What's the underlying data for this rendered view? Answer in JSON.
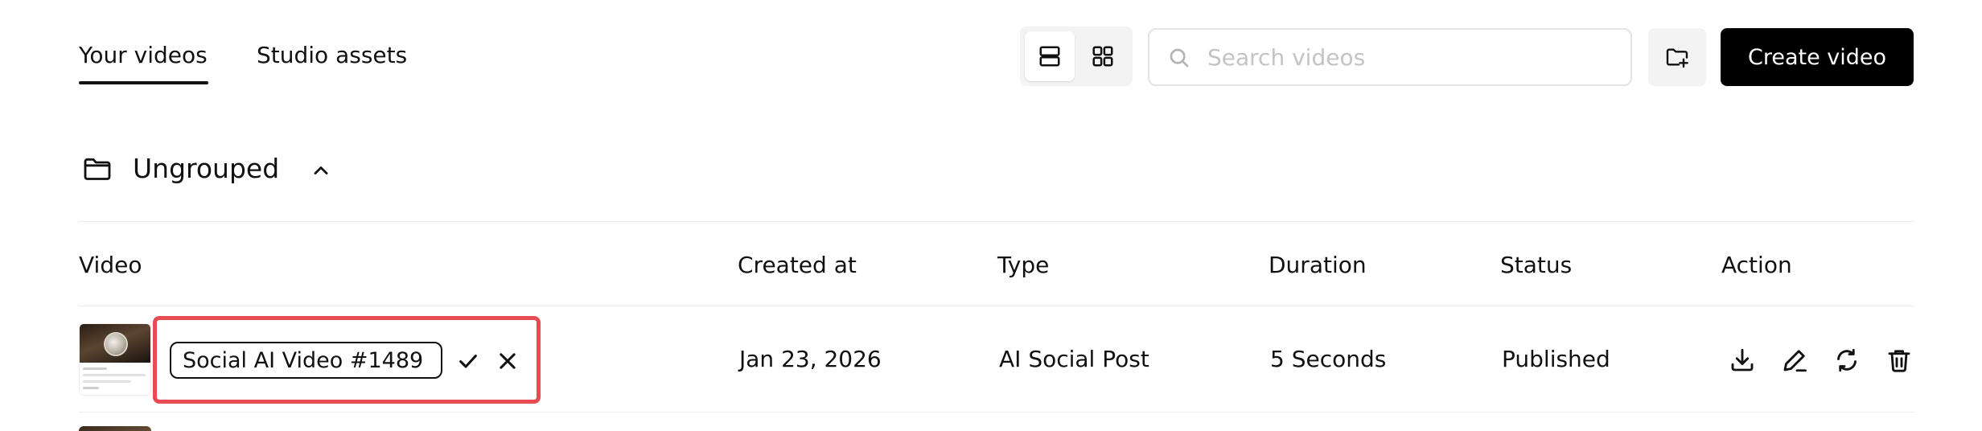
{
  "tabs": {
    "your_videos": "Your videos",
    "studio_assets": "Studio assets"
  },
  "toolbar": {
    "list_view_icon": "list-view-icon",
    "grid_view_icon": "grid-view-icon",
    "search_placeholder": "Search videos",
    "search_value": "",
    "new_folder_icon": "folder-plus-icon",
    "create_label": "Create video"
  },
  "group": {
    "title": "Ungrouped",
    "expanded": true
  },
  "table": {
    "headers": {
      "video": "Video",
      "created_at": "Created at",
      "type": "Type",
      "duration": "Duration",
      "status": "Status",
      "action": "Action"
    },
    "rows": [
      {
        "name": "Social AI Video #1489",
        "created_at": "Jan 23, 2026",
        "type": "AI Social Post",
        "duration": "5 Seconds",
        "status": "Published",
        "editing": true,
        "actions": [
          "download-icon",
          "edit-icon",
          "refresh-icon",
          "trash-icon"
        ]
      }
    ]
  },
  "colors": {
    "accent_border": "#e84b51",
    "primary_button": "#000000",
    "text": "#111111",
    "muted_bg": "#f3f3f3"
  }
}
